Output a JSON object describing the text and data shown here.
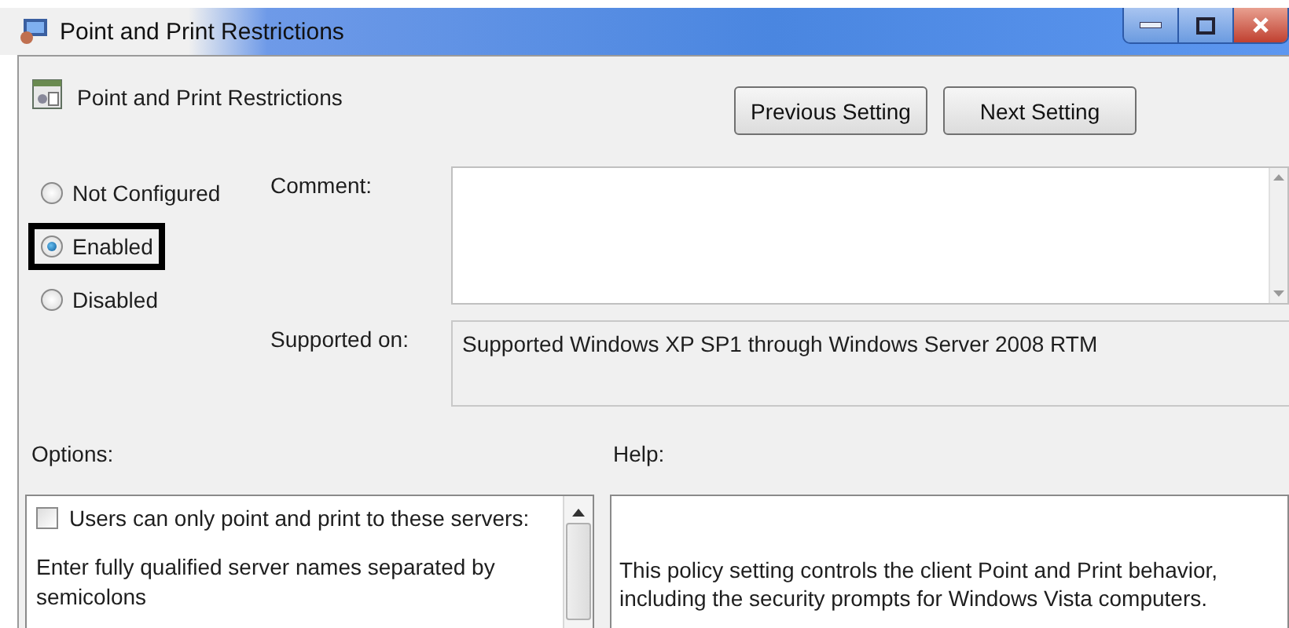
{
  "window": {
    "title": "Point and Print Restrictions"
  },
  "setting": {
    "title": "Point and Print Restrictions"
  },
  "buttons": [
    "Previous Setting",
    "Next Setting"
  ],
  "state_options": [
    {
      "label": "Not Configured",
      "selected": false
    },
    {
      "label": "Enabled",
      "selected": true
    },
    {
      "label": "Disabled",
      "selected": false
    }
  ],
  "comment": {
    "label": "Comment:"
  },
  "supported_on": {
    "label": "Supported on:",
    "value": "Supported Windows XP SP1 through Windows Server 2008 RTM"
  },
  "options": {
    "label": "Options:",
    "items": [
      {
        "kind": "checkbox",
        "label": "Users can only point and print to these servers:",
        "checked": false
      },
      {
        "kind": "text",
        "text": "Enter fully qualified server names separated by semicolons"
      }
    ]
  },
  "help": {
    "label": "Help:",
    "paragraphs": [
      "This policy setting controls the client Point and Print behavior, including the security prompts for Windows Vista computers."
    ]
  }
}
